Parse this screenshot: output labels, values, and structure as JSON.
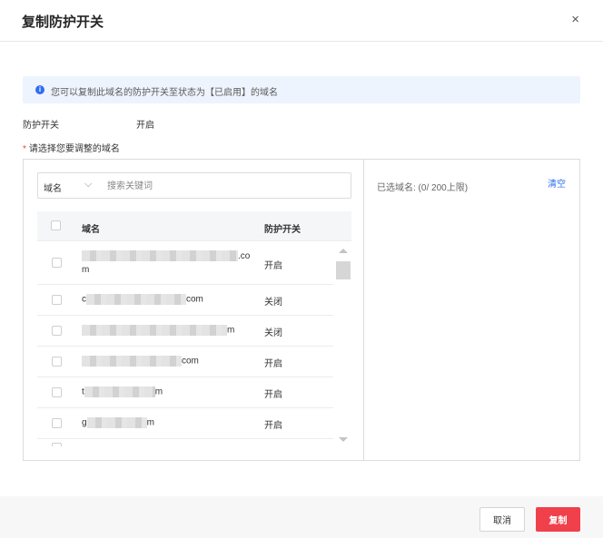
{
  "dialog": {
    "title": "复制防护开关",
    "close_glyph": "×"
  },
  "info": {
    "icon": "info-icon",
    "text": "您可以复制此域名的防护开关至状态为【已启用】的域名"
  },
  "protection": {
    "label": "防护开关",
    "value": "开启"
  },
  "domain_select": {
    "label": "请选择您要调整的域名"
  },
  "search": {
    "field": "域名",
    "placeholder": "搜索关键词"
  },
  "table": {
    "headers": {
      "name": "域名",
      "switch": "防护开关"
    },
    "rows": [
      {
        "name_prefix": "",
        "name_suffix": ".co",
        "name_line2": "m",
        "status": "开启"
      },
      {
        "name_prefix": "c",
        "name_suffix": "com",
        "status": "关闭"
      },
      {
        "name_prefix": "",
        "name_suffix": "m",
        "status": "关闭"
      },
      {
        "name_prefix": "",
        "name_suffix": "com",
        "status": "开启"
      },
      {
        "name_prefix": "t",
        "name_suffix": "m",
        "status": "开启"
      },
      {
        "name_prefix": "g",
        "name_suffix": "m",
        "status": "开启"
      }
    ]
  },
  "selected": {
    "text": "已选域名: (0/ 200上限)",
    "clear_label": "清空"
  },
  "footer": {
    "cancel_label": "取消",
    "copy_label": "复制"
  },
  "colors": {
    "accent": "#2f6ef0",
    "danger": "#f0404b"
  }
}
